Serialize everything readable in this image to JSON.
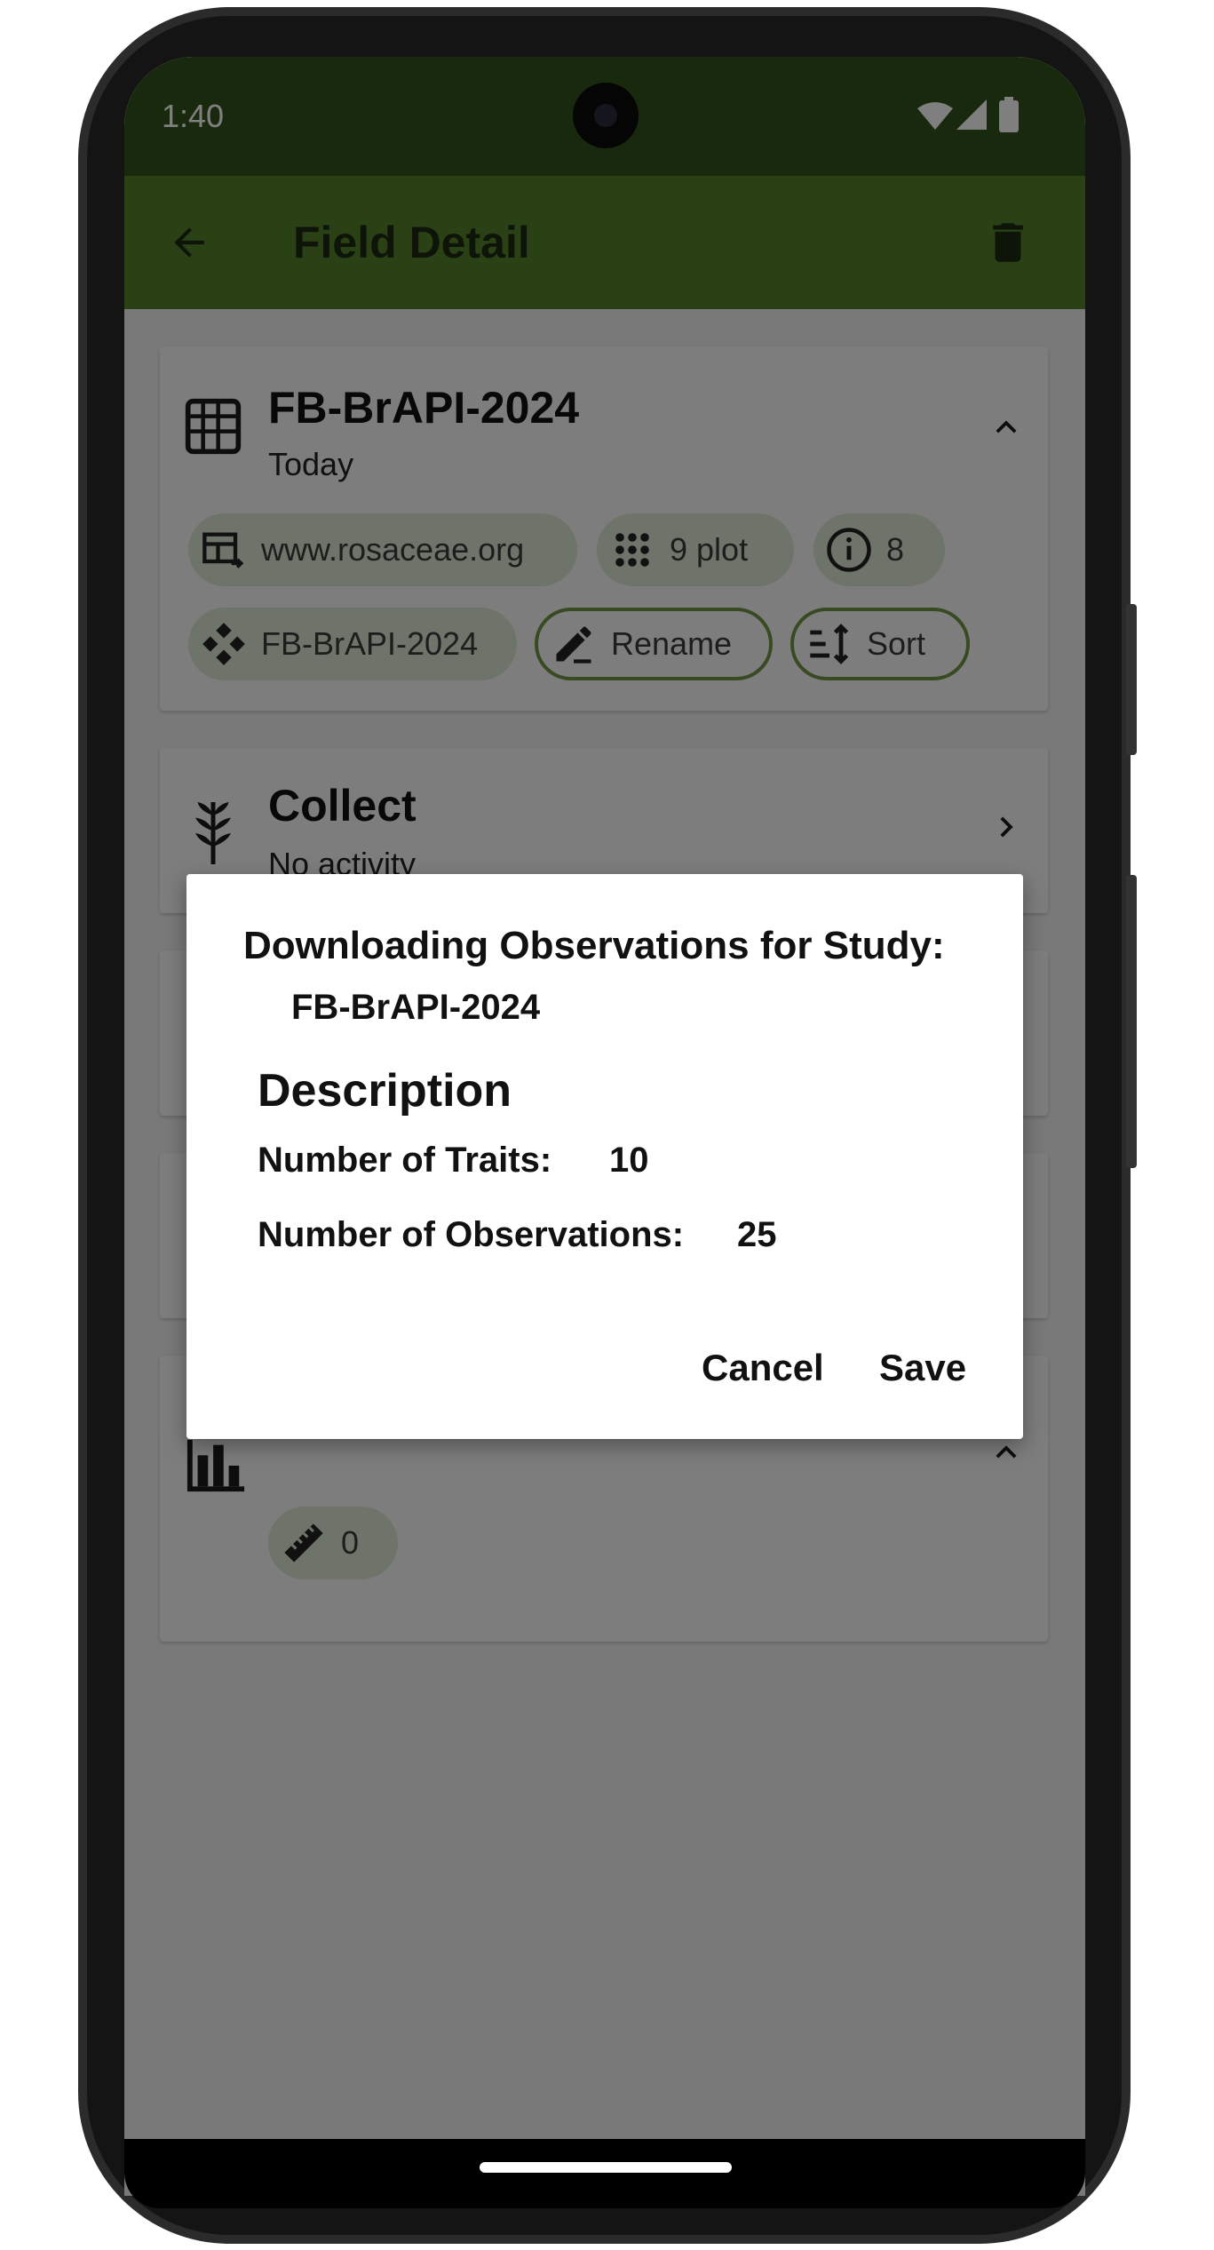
{
  "status_bar": {
    "time": "1:40"
  },
  "app_bar": {
    "title": "Field Detail"
  },
  "field_card": {
    "title": "FB-BrAPI-2024",
    "subtitle": "Today",
    "chips": {
      "source": "www.rosaceae.org",
      "plots": "9 plot",
      "info": "8",
      "study": "FB-BrAPI-2024",
      "rename": "Rename",
      "sort": "Sort"
    }
  },
  "collect_card": {
    "title": "Collect",
    "subtitle": "No activity"
  },
  "stats_card": {
    "traits_count": "0"
  },
  "dialog": {
    "title": "Downloading Observations for Study:",
    "study_name": "FB-BrAPI-2024",
    "section_heading": "Description",
    "traits_label": "Number of Traits:",
    "traits_value": "10",
    "observations_label": "Number of Observations:",
    "observations_value": "25",
    "cancel_label": "Cancel",
    "save_label": "Save"
  },
  "colors": {
    "status_bar": "#32531a",
    "app_bar": "#55822c",
    "chip_fill": "#dde9d3",
    "chip_outline": "#6e9445"
  }
}
